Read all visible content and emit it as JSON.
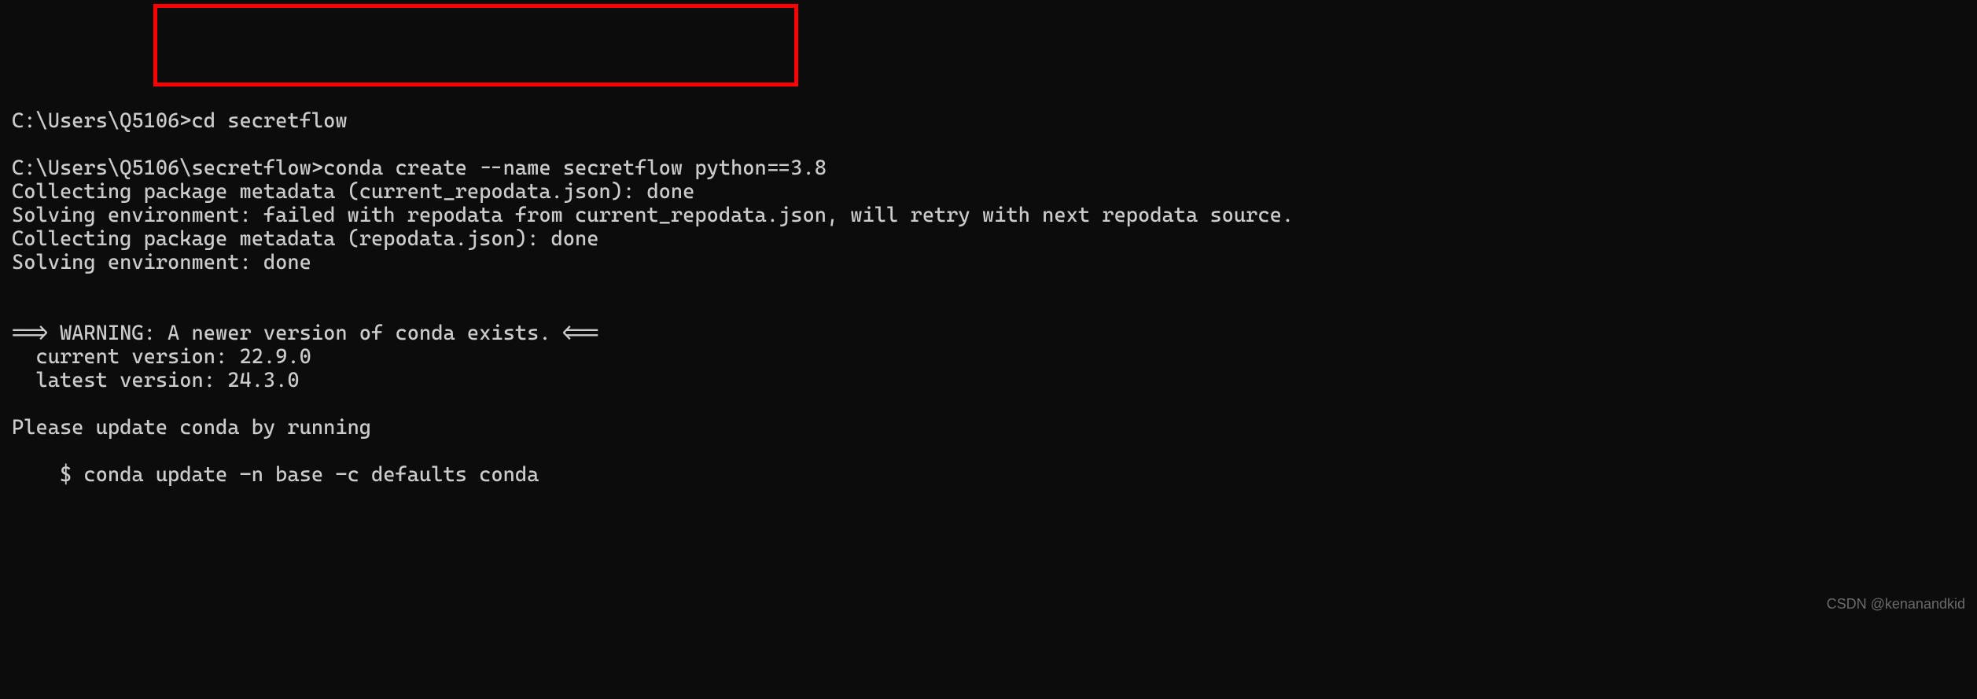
{
  "terminal": {
    "lines": [
      "C:\\Users\\Q5106>cd secretflow",
      "",
      "C:\\Users\\Q5106\\secretflow>conda create --name secretflow python==3.8",
      "Collecting package metadata (current_repodata.json): done",
      "Solving environment: failed with repodata from current_repodata.json, will retry with next repodata source.",
      "Collecting package metadata (repodata.json): done",
      "Solving environment: done",
      "",
      "",
      "==> WARNING: A newer version of conda exists. <==",
      "  current version: 22.9.0",
      "  latest version: 24.3.0",
      "",
      "Please update conda by running",
      "",
      "    $ conda update -n base -c defaults conda"
    ]
  },
  "watermark": "CSDN @kenanandkid"
}
